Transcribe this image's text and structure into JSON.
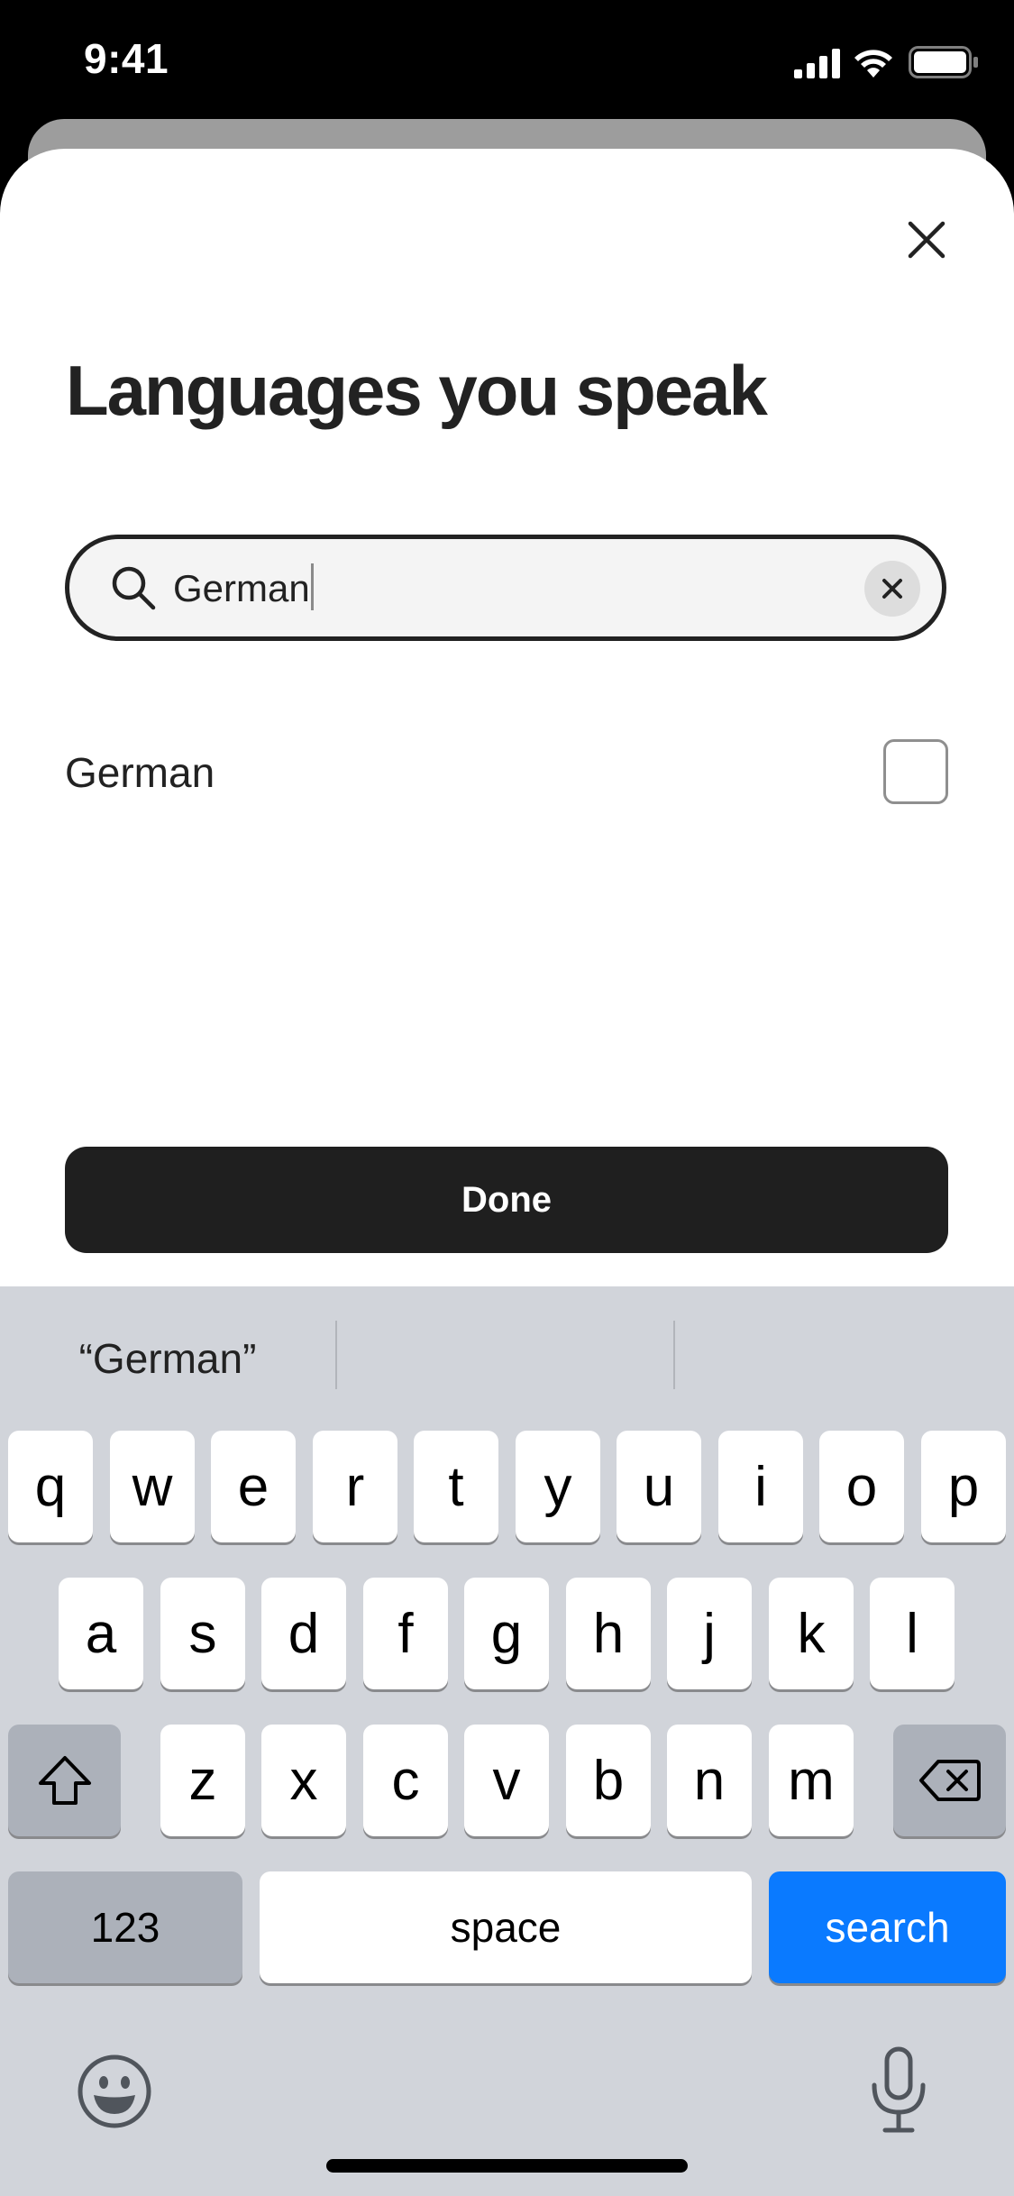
{
  "status_bar": {
    "time": "9:41",
    "icons": [
      "cellular-signal-icon",
      "wifi-icon",
      "battery-icon"
    ]
  },
  "modal": {
    "title": "Languages you speak",
    "close_icon": "close-icon"
  },
  "search": {
    "value": "German",
    "search_icon": "search-icon",
    "clear_icon": "clear-icon"
  },
  "results": [
    {
      "label": "German",
      "checked": false
    }
  ],
  "done_label": "Done",
  "keyboard": {
    "suggestions": [
      "“German”",
      "",
      ""
    ],
    "rows": [
      [
        "q",
        "w",
        "e",
        "r",
        "t",
        "y",
        "u",
        "i",
        "o",
        "p"
      ],
      [
        "a",
        "s",
        "d",
        "f",
        "g",
        "h",
        "j",
        "k",
        "l"
      ],
      [
        "z",
        "x",
        "c",
        "v",
        "b",
        "n",
        "m"
      ]
    ],
    "numbers_label": "123",
    "space_label": "space",
    "search_label": "search",
    "shift_icon": "shift-icon",
    "backspace_icon": "backspace-icon",
    "emoji_icon": "emoji-icon",
    "microphone_icon": "microphone-icon"
  },
  "colors": {
    "accent_blue": "#0a7aff",
    "primary_dark": "#1f1f1f",
    "keyboard_bg": "#d1d4da"
  }
}
